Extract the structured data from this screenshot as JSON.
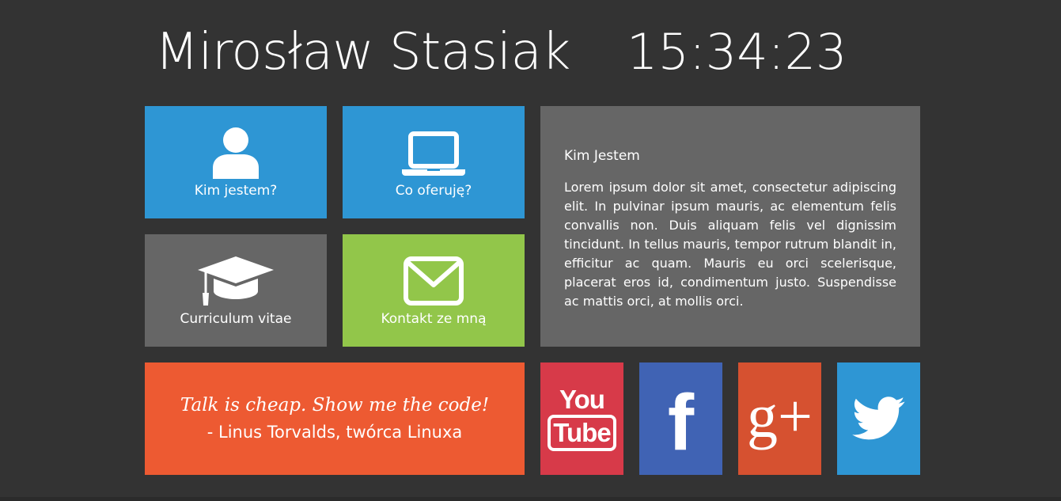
{
  "header": {
    "name": "Mirosław Stasiak",
    "clock": "15:34:23"
  },
  "tiles": {
    "about": {
      "label": "Kim jestem?",
      "icon": "user-icon",
      "color": "#2e96d4"
    },
    "offer": {
      "label": "Co oferuję?",
      "icon": "laptop-icon",
      "color": "#2e96d4"
    },
    "cv": {
      "label": "Curriculum vitae",
      "icon": "graduation-cap-icon",
      "color": "#666666"
    },
    "contact": {
      "label": "Kontakt ze mną",
      "icon": "envelope-icon",
      "color": "#92c64a"
    }
  },
  "info": {
    "title": "Kim Jestem",
    "text": "Lorem ipsum dolor sit amet, consectetur adipiscing elit. In pulvinar ipsum mauris, ac elementum felis convallis non. Duis aliquam felis vel dignissim tincidunt. In tellus mauris, tempor rutrum blandit in, efficitur ac quam. Mauris eu orci scelerisque, placerat eros id, condimentum justo. Suspendisse ac mattis orci, at mollis orci."
  },
  "quote": {
    "text": "Talk is cheap. Show me the code!",
    "author": "- Linus Torvalds, twórca Linuxa"
  },
  "social": {
    "youtube": {
      "top": "You",
      "bottom": "Tube",
      "icon": "youtube-icon",
      "color": "#d73a49"
    },
    "facebook": {
      "glyph": "f",
      "icon": "facebook-icon",
      "color": "#4063b4"
    },
    "gplus": {
      "glyph": "g+",
      "icon": "google-plus-icon",
      "color": "#d65130"
    },
    "twitter": {
      "icon": "twitter-bird-icon",
      "color": "#2e96d4"
    }
  },
  "colors": {
    "background": "#333333",
    "text": "#ffffff"
  }
}
